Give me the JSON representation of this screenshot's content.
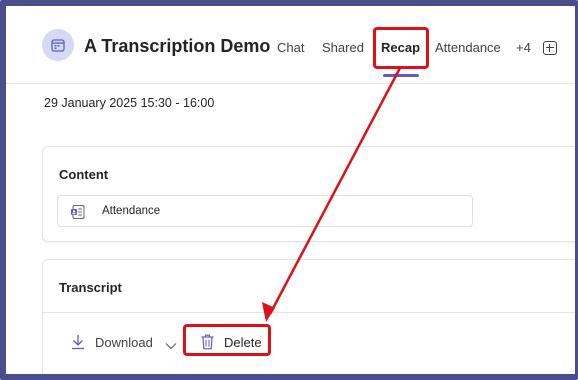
{
  "meeting": {
    "title": "A Transcription Demo",
    "datetime": "29 January 2025 15:30 - 16:00"
  },
  "tabs": [
    {
      "label": "Chat",
      "active": false
    },
    {
      "label": "Shared",
      "active": false
    },
    {
      "label": "Recap",
      "active": true
    },
    {
      "label": "Attendance",
      "active": false
    },
    {
      "label": "+4",
      "active": false
    }
  ],
  "content_card": {
    "title": "Content",
    "attachment_label": "Attendance"
  },
  "transcript_card": {
    "title": "Transcript",
    "download_label": "Download",
    "delete_label": "Delete"
  },
  "colors": {
    "accent": "#5b5fc7",
    "annotation": "#e0101a",
    "frame": "#4a4f8c"
  },
  "icons": [
    "calendar-icon",
    "add-tab-icon",
    "attendance-file-icon",
    "download-icon",
    "chevron-down-icon",
    "trash-icon"
  ]
}
